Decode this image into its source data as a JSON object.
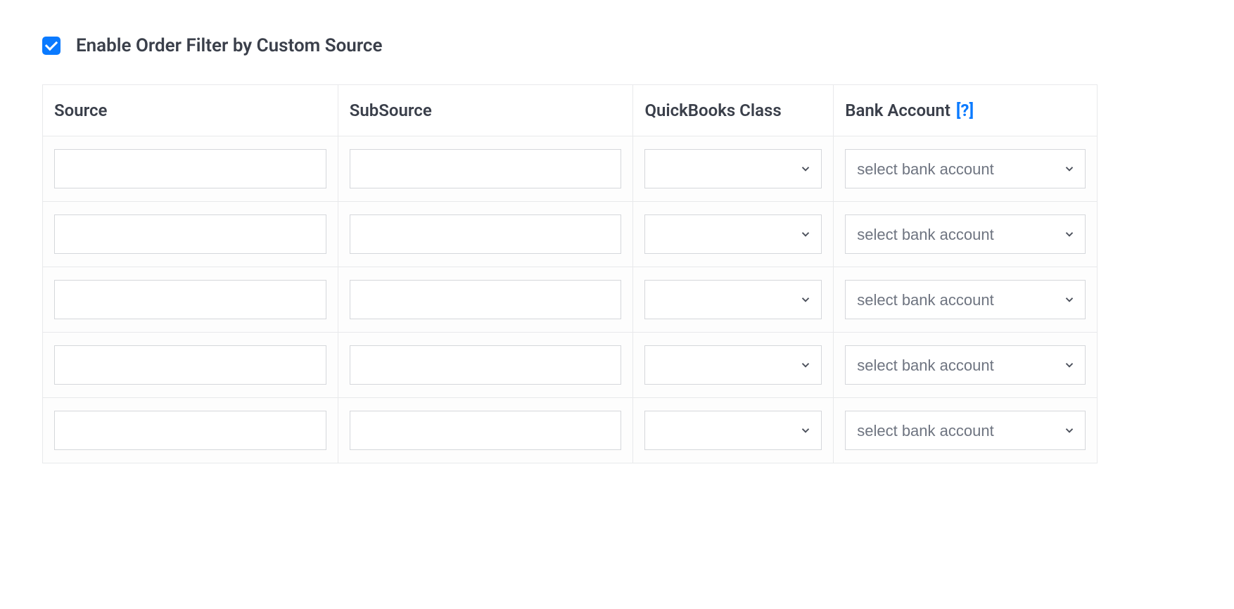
{
  "enable": {
    "checked": true,
    "label": "Enable Order Filter by Custom Source"
  },
  "table": {
    "headers": {
      "source": "Source",
      "subsource": "SubSource",
      "qbclass": "QuickBooks Class",
      "bank": "Bank Account",
      "bank_help": "[?]"
    },
    "bank_placeholder": "select bank account",
    "rows": [
      {
        "source": "",
        "subsource": "",
        "qbclass": "",
        "bank": "select bank account"
      },
      {
        "source": "",
        "subsource": "",
        "qbclass": "",
        "bank": "select bank account"
      },
      {
        "source": "",
        "subsource": "",
        "qbclass": "",
        "bank": "select bank account"
      },
      {
        "source": "",
        "subsource": "",
        "qbclass": "",
        "bank": "select bank account"
      },
      {
        "source": "",
        "subsource": "",
        "qbclass": "",
        "bank": "select bank account"
      }
    ]
  }
}
